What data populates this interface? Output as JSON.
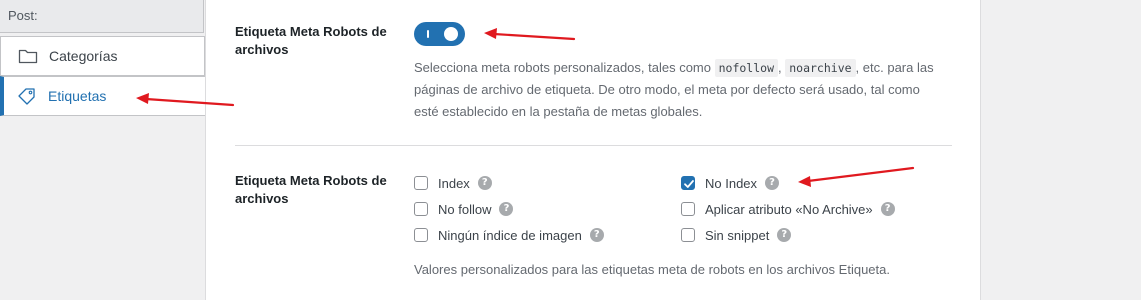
{
  "sidebar": {
    "header": "Post:",
    "items": [
      {
        "label": "Categorías",
        "icon": "folder-icon"
      },
      {
        "label": "Etiquetas",
        "icon": "tag-icon",
        "active": true
      }
    ]
  },
  "rows": [
    {
      "label": "Etiqueta Meta Robots de archivos",
      "toggle_on": true,
      "desc_before": "Selecciona meta robots personalizados, tales como ",
      "code1": "nofollow",
      "sep": ", ",
      "code2": "noarchive",
      "desc_after": ", etc. para las páginas de archivo de etiqueta. De otro modo, el meta por defecto será usado, tal como esté establecido en la pestaña de metas globales."
    },
    {
      "label": "Etiqueta Meta Robots de archivos",
      "options": [
        {
          "label": "Index",
          "checked": false
        },
        {
          "label": "No follow",
          "checked": false
        },
        {
          "label": "Ningún índice de imagen",
          "checked": false
        },
        {
          "label": "No Index",
          "checked": true
        },
        {
          "label": "Aplicar atributo «No Archive»",
          "checked": false
        },
        {
          "label": "Sin snippet",
          "checked": false
        }
      ],
      "help_glyph": "?",
      "desc": "Valores personalizados para las etiquetas meta de robots en los archivos Etiqueta."
    }
  ],
  "colors": {
    "accent": "#2271b1",
    "annotation_arrow": "#e0191f"
  }
}
